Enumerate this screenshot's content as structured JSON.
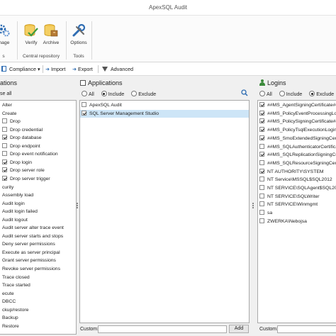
{
  "window": {
    "title": "ApexSQL Audit"
  },
  "ribbon": {
    "manage_label": "anage",
    "verify_label": "Verify",
    "archive_label": "Archive",
    "options_label": "Options",
    "group_left_label": "s",
    "group_central_label": "Central repository",
    "group_tools_label": "Tools"
  },
  "toolbar": {
    "compliance_label": "Compliance",
    "import_label": "Import",
    "export_label": "Export",
    "advanced_label": "Advanced"
  },
  "operations": {
    "title": "ations",
    "select_all_label": "se all",
    "items": [
      {
        "label": "Alter",
        "type": "text",
        "indent": 1
      },
      {
        "label": "Create",
        "type": "text",
        "indent": 1
      },
      {
        "label": "Drop",
        "type": "check",
        "checked": false,
        "indent": 1
      },
      {
        "label": "Drop credential",
        "type": "check",
        "checked": false,
        "indent": 1
      },
      {
        "label": "Drop database",
        "type": "check",
        "checked": true,
        "indent": 1
      },
      {
        "label": "Drop endpoint",
        "type": "check",
        "checked": false,
        "indent": 1
      },
      {
        "label": "Drop event notification",
        "type": "check",
        "checked": false,
        "indent": 1
      },
      {
        "label": "Drop login",
        "type": "check",
        "checked": true,
        "indent": 1
      },
      {
        "label": "Drop server role",
        "type": "check",
        "checked": true,
        "indent": 1
      },
      {
        "label": "Drop server trigger",
        "type": "check",
        "checked": true,
        "indent": 1
      },
      {
        "label": "curity",
        "type": "text",
        "indent": 0
      },
      {
        "label": "Assembly load",
        "type": "text",
        "indent": 1
      },
      {
        "label": "Audit login",
        "type": "text",
        "indent": 1
      },
      {
        "label": "Audit login failed",
        "type": "text",
        "indent": 1
      },
      {
        "label": "Audit logout",
        "type": "text",
        "indent": 1
      },
      {
        "label": "Audit server alter trace event",
        "type": "text",
        "indent": 1
      },
      {
        "label": "Audit server starts and stops",
        "type": "text",
        "indent": 1
      },
      {
        "label": "Deny server permissions",
        "type": "text",
        "indent": 1
      },
      {
        "label": "Execute as server principal",
        "type": "text",
        "indent": 1
      },
      {
        "label": "Grant server permissions",
        "type": "text",
        "indent": 1
      },
      {
        "label": "Revoke server permissions",
        "type": "text",
        "indent": 1
      },
      {
        "label": "Trace closed",
        "type": "text",
        "indent": 1
      },
      {
        "label": "Trace started",
        "type": "text",
        "indent": 1
      },
      {
        "label": "ecute",
        "type": "text",
        "indent": 0
      },
      {
        "label": "DBCC",
        "type": "text",
        "indent": 1
      },
      {
        "label": "ckup/restore",
        "type": "text",
        "indent": 0
      },
      {
        "label": "Backup",
        "type": "text",
        "indent": 1
      },
      {
        "label": "Restore",
        "type": "text",
        "indent": 1
      }
    ]
  },
  "applications": {
    "title": "Applications",
    "filter_all": "All",
    "filter_include": "Include",
    "filter_exclude": "Exclude",
    "selected_filter": "Include",
    "items": [
      {
        "label": "ApexSQL Audit",
        "checked": false,
        "selected": false
      },
      {
        "label": "SQL Server Management Studio",
        "checked": true,
        "selected": true
      }
    ],
    "custom_label": "Custom:",
    "custom_value": "",
    "add_label": "Add"
  },
  "logins": {
    "title": "Logins",
    "filter_all": "All",
    "filter_include": "Include",
    "filter_exclude": "Exclude",
    "selected_filter": "Exclude",
    "items": [
      {
        "label": "##MS_AgentSigningCertificate##",
        "checked": true
      },
      {
        "label": "##MS_PolicyEventProcessingLogi",
        "checked": true
      },
      {
        "label": "##MS_PolicySigningCertificate##",
        "checked": true
      },
      {
        "label": "##MS_PolicyTsqlExecutionLogin#",
        "checked": true
      },
      {
        "label": "##MS_SmoExtendedSigningCerti",
        "checked": true
      },
      {
        "label": "##MS_SQLAuthenticatorCertificat",
        "checked": false
      },
      {
        "label": "##MS_SQLReplicationSigningCer",
        "checked": true
      },
      {
        "label": "##MS_SQLResourceSigningCertif",
        "checked": false
      },
      {
        "label": "NT AUTHORITY\\SYSTEM",
        "checked": true
      },
      {
        "label": "NT Service\\MSSQL$SQL2012",
        "checked": false
      },
      {
        "label": "NT SERVICE\\SQLAgent$SQL2012",
        "checked": false
      },
      {
        "label": "NT SERVICE\\SQLWriter",
        "checked": false
      },
      {
        "label": "NT SERVICE\\Winmgmt",
        "checked": false
      },
      {
        "label": "sa",
        "checked": false
      },
      {
        "label": "ZWERKA\\Nebojsa",
        "checked": false
      }
    ],
    "custom_label": "Custom:"
  },
  "colors": {
    "accent": "#2b7bd1",
    "selection": "#cde5f7",
    "logins_icon": "#3b8a3b"
  }
}
